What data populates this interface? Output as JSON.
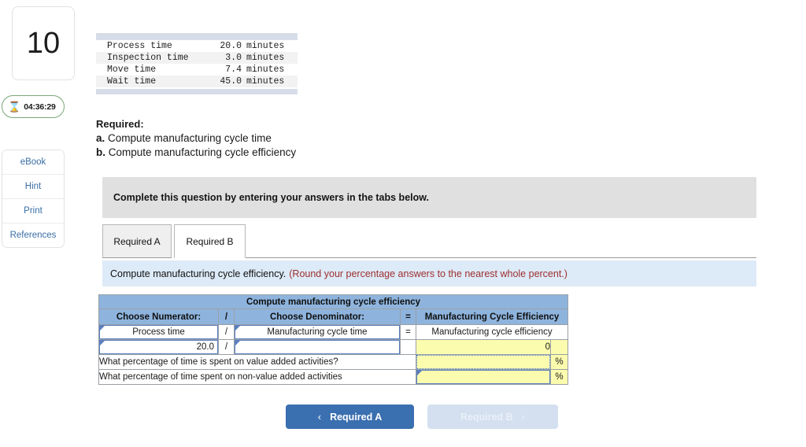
{
  "question": {
    "number": "10"
  },
  "timer": {
    "icon": "hourglass-icon",
    "value": "04:36:29"
  },
  "resources": {
    "items": [
      {
        "label": "eBook"
      },
      {
        "label": "Hint"
      },
      {
        "label": "Print"
      },
      {
        "label": "References"
      }
    ]
  },
  "facts": {
    "rows": [
      {
        "label": "Process time",
        "value": "20.0",
        "unit": "minutes"
      },
      {
        "label": "Inspection time",
        "value": "3.0",
        "unit": "minutes"
      },
      {
        "label": "Move time",
        "value": "7.4",
        "unit": "minutes"
      },
      {
        "label": "Wait time",
        "value": "45.0",
        "unit": "minutes"
      }
    ]
  },
  "required": {
    "heading": "Required:",
    "item_a_marker": "a.",
    "item_a": "Compute manufacturing cycle time",
    "item_b_marker": "b.",
    "item_b": "Compute manufacturing cycle efficiency"
  },
  "instruction": {
    "text": "Complete this question by entering your answers in the tabs below."
  },
  "tabs": {
    "required_a": "Required A",
    "required_b": "Required B"
  },
  "sub_instruction": {
    "text": "Compute manufacturing cycle efficiency.",
    "round_note": "(Round your percentage answers to the nearest whole percent.)"
  },
  "sheet": {
    "title": "Compute manufacturing cycle efficiency",
    "headers": {
      "numerator": "Choose Numerator:",
      "slash": "/",
      "denominator": "Choose Denominator:",
      "equals": "=",
      "result": "Manufacturing Cycle Efficiency"
    },
    "row_labels": {
      "numerator_label": "Process time",
      "slash": "/",
      "denominator_label": "Manufacturing cycle time",
      "equals": "=",
      "result_label": "Manufacturing cycle efficiency"
    },
    "row_values": {
      "numerator_value": "20.0",
      "slash": "/",
      "denominator_value": "",
      "result_value": "0"
    },
    "questions": [
      {
        "text": "What percentage of time is spent on value added activities?",
        "answer": "",
        "unit": "%"
      },
      {
        "text": "What percentage of time spent on non-value added activities",
        "answer": "",
        "unit": "%"
      }
    ]
  },
  "bottom_nav": {
    "prev_label": "Required A",
    "prev_icon": "chevron-left-icon",
    "next_label": "Required B",
    "next_icon": "chevron-right-icon"
  },
  "colors": {
    "sheet_header_blue": "#8eb4dd",
    "input_yellow": "#fcfcae",
    "sub_instruction_blue": "#ddeaf7",
    "instruction_gray": "#e0e0e0",
    "nav_primary": "#3a6fb0",
    "nav_disabled": "#d4e0ef",
    "note_red": "#9d2f2f",
    "link_blue": "#3a6ea5",
    "timer_green": "#7aa87a"
  }
}
